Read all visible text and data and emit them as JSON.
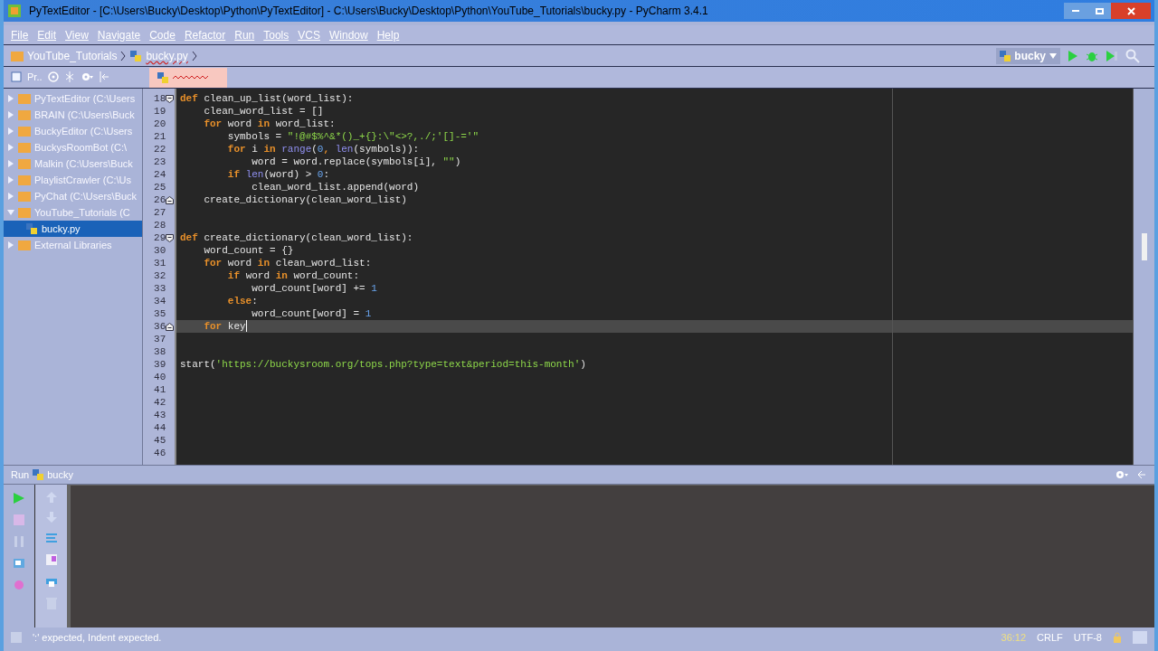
{
  "window": {
    "title": "PyTextEditor - [C:\\Users\\Bucky\\Desktop\\Python\\PyTextEditor] - C:\\Users\\Bucky\\Desktop\\Python\\YouTube_Tutorials\\bucky.py - PyCharm 3.4.1"
  },
  "menu": [
    "File",
    "Edit",
    "View",
    "Navigate",
    "Code",
    "Refactor",
    "Run",
    "Tools",
    "VCS",
    "Window",
    "Help"
  ],
  "breadcrumbs": [
    "YouTube_Tutorials",
    "bucky.py"
  ],
  "run_config": {
    "label": "bucky"
  },
  "project_panel": {
    "title": "Pr..",
    "items": [
      {
        "name": "PyTextEditor",
        "path": "(C:\\Users",
        "expanded": false,
        "selected": false
      },
      {
        "name": "BRAIN",
        "path": "(C:\\Users\\Buck",
        "expanded": false,
        "selected": false
      },
      {
        "name": "BuckyEditor",
        "path": "(C:\\Users",
        "expanded": false,
        "selected": false
      },
      {
        "name": "BuckysRoomBot",
        "path": "(C:\\",
        "expanded": false,
        "selected": false
      },
      {
        "name": "Malkin",
        "path": "(C:\\Users\\Buck",
        "expanded": false,
        "selected": false
      },
      {
        "name": "PlaylistCrawler",
        "path": "(C:\\Us",
        "expanded": false,
        "selected": false
      },
      {
        "name": "PyChat",
        "path": "(C:\\Users\\Buck",
        "expanded": false,
        "selected": false
      },
      {
        "name": "YouTube_Tutorials",
        "path": "(C",
        "expanded": true,
        "selected": false,
        "children": [
          {
            "name": "bucky.py",
            "selected": true
          }
        ]
      },
      {
        "name": "External Libraries",
        "expanded": false,
        "selected": false
      }
    ]
  },
  "editor": {
    "lines": [
      {
        "n": "18",
        "fold_start": true,
        "tokens": [
          {
            "t": "def ",
            "kind": "kw"
          },
          {
            "t": "clean_up_list(word_list):",
            "kind": "plain"
          }
        ]
      },
      {
        "n": "19",
        "tokens": [
          {
            "t": "    clean_word_list = []",
            "kind": "plain"
          }
        ]
      },
      {
        "n": "20",
        "tokens": [
          {
            "t": "    for ",
            "kind": "kw"
          },
          {
            "t": "word ",
            "kind": "plain"
          },
          {
            "t": "in ",
            "kind": "kw"
          },
          {
            "t": "word_list:",
            "kind": "plain"
          }
        ]
      },
      {
        "n": "21",
        "tokens": [
          {
            "t": "        symbols = ",
            "kind": "plain"
          },
          {
            "t": "\"!@#$%^&*()_+{}:\\\"<>?,./;'[]-='\"",
            "kind": "str"
          }
        ]
      },
      {
        "n": "22",
        "tokens": [
          {
            "t": "        for ",
            "kind": "kw"
          },
          {
            "t": "i ",
            "kind": "plain"
          },
          {
            "t": "in ",
            "kind": "kw"
          },
          {
            "t": "range",
            "kind": "builtin"
          },
          {
            "t": "(",
            "kind": "plain"
          },
          {
            "t": "0",
            "kind": "num"
          },
          {
            "t": ", ",
            "kind": "kw"
          },
          {
            "t": "len",
            "kind": "builtin"
          },
          {
            "t": "(symbols)):",
            "kind": "plain"
          }
        ]
      },
      {
        "n": "23",
        "tokens": [
          {
            "t": "            word = word.replace(symbols[i], ",
            "kind": "plain"
          },
          {
            "t": "\"\"",
            "kind": "str"
          },
          {
            "t": ")",
            "kind": "plain"
          }
        ]
      },
      {
        "n": "24",
        "tokens": [
          {
            "t": "        if ",
            "kind": "kw"
          },
          {
            "t": "len",
            "kind": "builtin"
          },
          {
            "t": "(word) > ",
            "kind": "plain"
          },
          {
            "t": "0",
            "kind": "num"
          },
          {
            "t": ":",
            "kind": "plain"
          }
        ]
      },
      {
        "n": "25",
        "tokens": [
          {
            "t": "            clean_word_list.append(word)",
            "kind": "plain"
          }
        ]
      },
      {
        "n": "26",
        "fold_end": true,
        "tokens": [
          {
            "t": "    create_dictionary(clean_word_list)",
            "kind": "plain"
          }
        ]
      },
      {
        "n": "27"
      },
      {
        "n": "28"
      },
      {
        "n": "29",
        "fold_start": true,
        "tokens": [
          {
            "t": "def ",
            "kind": "kw"
          },
          {
            "t": "create_dictionary(clean_word_list):",
            "kind": "plain"
          }
        ]
      },
      {
        "n": "30",
        "tokens": [
          {
            "t": "    word_count = {}",
            "kind": "plain"
          }
        ]
      },
      {
        "n": "31",
        "tokens": [
          {
            "t": "    for ",
            "kind": "kw"
          },
          {
            "t": "word ",
            "kind": "plain"
          },
          {
            "t": "in ",
            "kind": "kw"
          },
          {
            "t": "clean_word_list:",
            "kind": "plain"
          }
        ]
      },
      {
        "n": "32",
        "tokens": [
          {
            "t": "        if ",
            "kind": "kw"
          },
          {
            "t": "word ",
            "kind": "plain"
          },
          {
            "t": "in ",
            "kind": "kw"
          },
          {
            "t": "word_count:",
            "kind": "plain"
          }
        ]
      },
      {
        "n": "33",
        "tokens": [
          {
            "t": "            word_count[word] += ",
            "kind": "plain"
          },
          {
            "t": "1",
            "kind": "num"
          }
        ]
      },
      {
        "n": "34",
        "tokens": [
          {
            "t": "        else",
            "kind": "kw"
          },
          {
            "t": ":",
            "kind": "plain"
          }
        ]
      },
      {
        "n": "35",
        "tokens": [
          {
            "t": "            word_count[word] = ",
            "kind": "plain"
          },
          {
            "t": "1",
            "kind": "num"
          }
        ]
      },
      {
        "n": "36",
        "fold_end": true,
        "current": true,
        "tokens": [
          {
            "t": "    for ",
            "kind": "kw"
          },
          {
            "t": "key",
            "kind": "plain"
          }
        ]
      },
      {
        "n": "37"
      },
      {
        "n": "38"
      },
      {
        "n": "39",
        "tokens": [
          {
            "t": "start(",
            "kind": "plain"
          },
          {
            "t": "'https://buckysroom.org/tops.php?type=text&period=this-month'",
            "kind": "str"
          },
          {
            "t": ")",
            "kind": "plain"
          }
        ]
      },
      {
        "n": "40"
      },
      {
        "n": "41"
      },
      {
        "n": "42"
      },
      {
        "n": "43"
      },
      {
        "n": "44"
      },
      {
        "n": "45"
      },
      {
        "n": "46"
      }
    ]
  },
  "run_panel": {
    "title": "Run",
    "config": "bucky"
  },
  "status_bar": {
    "message": "':' expected, Indent expected.",
    "position": "36:12",
    "line_separator": "CRLF",
    "encoding": "UTF-8"
  }
}
